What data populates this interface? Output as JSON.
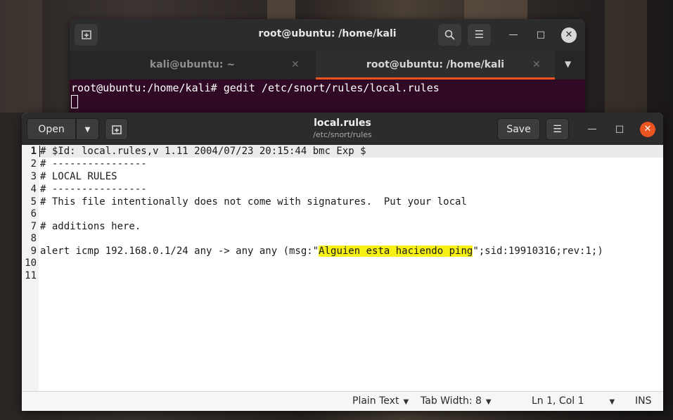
{
  "terminal": {
    "title": "root@ubuntu: /home/kali",
    "tabs": [
      {
        "label": "kali@ubuntu: ~",
        "active": false
      },
      {
        "label": "root@ubuntu: /home/kali",
        "active": true
      }
    ],
    "command_line": "root@ubuntu:/home/kali# gedit /etc/snort/rules/local.rules",
    "colors": {
      "background": "#300a24",
      "accent": "#e95420"
    },
    "icons": [
      "new-tab-icon",
      "search-icon",
      "hamburger-menu-icon",
      "minimize-icon",
      "maximize-icon",
      "close-icon",
      "tab-close-icon",
      "tabs-dropdown-icon"
    ]
  },
  "gedit": {
    "open_label": "Open",
    "save_label": "Save",
    "title": "local.rules",
    "subtitle": "/etc/snort/rules",
    "lines": [
      {
        "num": "1",
        "text": "# $Id: local.rules,v 1.11 2004/07/23 20:15:44 bmc Exp $"
      },
      {
        "num": "2",
        "text": "# ----------------"
      },
      {
        "num": "3",
        "text": "# LOCAL RULES"
      },
      {
        "num": "4",
        "text": "# ----------------"
      },
      {
        "num": "5",
        "text": "# This file intentionally does not come with signatures.  Put your local"
      },
      {
        "num": "6",
        "text": ""
      },
      {
        "num": "7",
        "text": "# additions here."
      },
      {
        "num": "8",
        "text": ""
      },
      {
        "num": "9",
        "text_before": "alert icmp 192.168.0.1/24 any -> any any (msg:\"",
        "highlight": "Alguien esta haciendo ping",
        "text_after": "\";sid:19910316;rev:1;)"
      },
      {
        "num": "10",
        "text": ""
      },
      {
        "num": "11",
        "text": ""
      }
    ],
    "status": {
      "language": "Plain Text",
      "tab_width": "Tab Width: 8",
      "position": "Ln 1, Col 1",
      "mode": "INS"
    },
    "colors": {
      "highlight": "#f7f015",
      "close_button": "#e95420"
    }
  }
}
